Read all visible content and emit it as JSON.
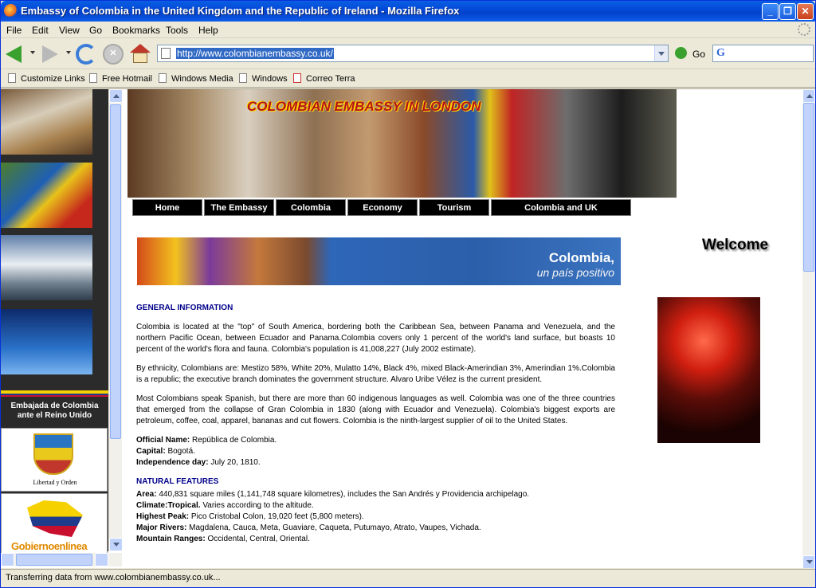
{
  "window": {
    "title": "Embassy of Colombia in the United Kingdom and the Republic of Ireland - Mozilla Firefox"
  },
  "menu": [
    "File",
    "Edit",
    "View",
    "Go",
    "Bookmarks",
    "Tools",
    "Help"
  ],
  "toolbar": {
    "url": "http://www.colombianembassy.co.uk/",
    "go_label": "Go",
    "search_logo": "G"
  },
  "bookmarks": [
    "Customize Links",
    "Free Hotmail",
    "Windows Media",
    "Windows",
    "Correo Terra"
  ],
  "left": {
    "label_line1": "Embajada de Colombia",
    "label_line2": "ante el Reino Unido",
    "shield_caption": "Libertad y Orden",
    "gob_text": "Gobiernoenlinea"
  },
  "banner": {
    "title": "COLOMBIAN  EMBASSY IN  LONDON"
  },
  "nav": [
    "Home",
    "The Embassy",
    "Colombia",
    "Economy",
    "Tourism",
    "Colombia and UK"
  ],
  "colombia_banner": {
    "line1": "Colombia,",
    "line2": "un país positivo"
  },
  "welcome": "Welcome",
  "article": {
    "heading1": "GENERAL INFORMATION",
    "p1": "Colombia is located at the \"top\" of South America, bordering both the Caribbean Sea, between Panama and Venezuela, and the northern Pacific Ocean, between Ecuador and Panama.Colombia covers only 1 percent of the world's land surface, but boasts 10 percent of the world's flora and fauna. Colombia's population is 41,008,227 (July 2002 estimate).",
    "p2": "By ethnicity, Colombians are: Mestizo 58%, White 20%, Mulatto 14%, Black 4%, mixed Black-Amerindian 3%, Amerindian 1%.Colombia is a republic; the executive branch dominates the government structure. Alvaro Uribe Vélez is the current president.",
    "p3": "Most Colombians speak Spanish, but there are more than 60 indigenous languages as well. Colombia was one of the three countries that emerged from the collapse of Gran Colombia in 1830 (along with Ecuador and Venezuela). Colombia's biggest exports are petroleum, coffee, coal, apparel, bananas and cut flowers. Colombia is the ninth-largest supplier of oil to the United States.",
    "facts1": [
      {
        "label": "Official Name:",
        "value": "República de Colombia."
      },
      {
        "label": "Capital:",
        "value": "Bogotá."
      },
      {
        "label": "Independence day:",
        "value": "July 20, 1810."
      }
    ],
    "heading2": "NATURAL FEATURES",
    "facts2": [
      {
        "label": "Area:",
        "value": "440,831 square miles (1,141,748 square kilometres), includes the San Andrés y Providencia archipelago."
      },
      {
        "label": "Climate:Tropical.",
        "value": "Varies according to the altitude."
      },
      {
        "label": "Highest Peak:",
        "value": "Pico Cristobal Colon, 19,020 feet (5,800 meters)."
      },
      {
        "label": "Major Rivers:",
        "value": "Magdalena, Cauca, Meta, Guaviare, Caqueta, Putumayo, Atrato, Vaupes, Vichada."
      },
      {
        "label": "Mountain Ranges:",
        "value": "Occidental, Central, Oriental."
      }
    ]
  },
  "status": "Transferring data from www.colombianembassy.co.uk..."
}
